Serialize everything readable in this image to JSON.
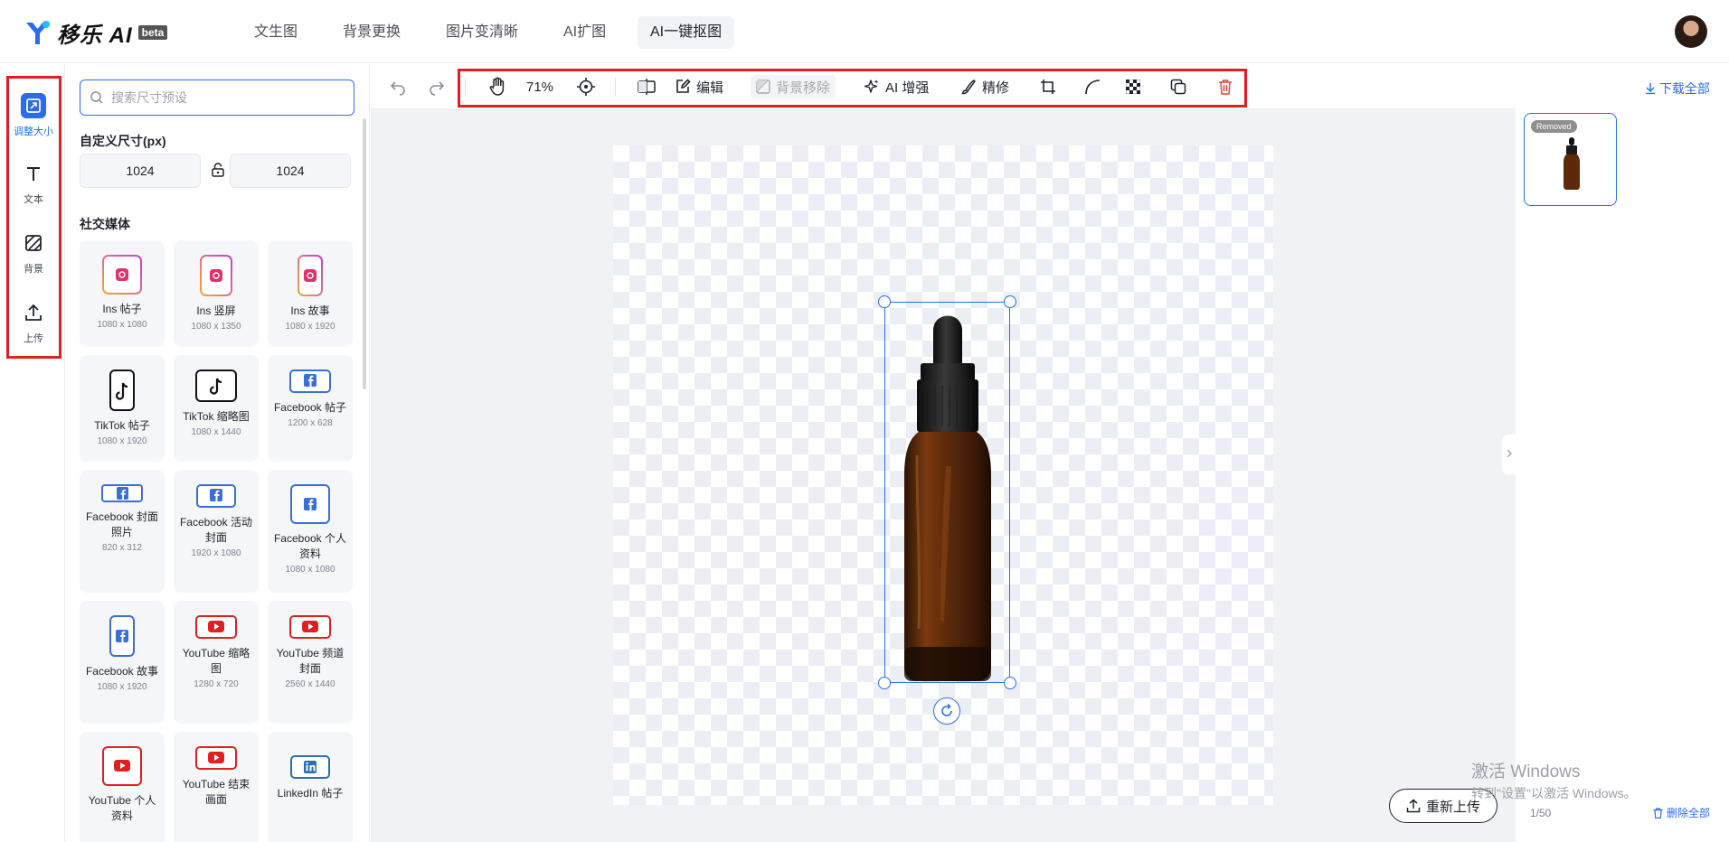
{
  "app": {
    "brand": "移乐 AI",
    "beta_badge": "beta"
  },
  "nav": {
    "tabs": [
      {
        "label": "文生图",
        "active": false
      },
      {
        "label": "背景更换",
        "active": false
      },
      {
        "label": "图片变清晰",
        "active": false
      },
      {
        "label": "AI扩图",
        "active": false
      },
      {
        "label": "AI一键抠图",
        "active": true
      }
    ]
  },
  "rail": {
    "items": [
      {
        "label": "调整大小",
        "icon": "resize-icon",
        "active": true
      },
      {
        "label": "文本",
        "icon": "text-icon",
        "active": false
      },
      {
        "label": "背景",
        "icon": "background-icon",
        "active": false
      },
      {
        "label": "上传",
        "icon": "upload-icon",
        "active": false
      }
    ]
  },
  "panel": {
    "search_placeholder": "搜索尺寸预设",
    "custom_size_label": "自定义尺寸(px)",
    "width": "1024",
    "height": "1024",
    "section_title": "社交媒体",
    "presets": [
      {
        "name": "Ins 帖子",
        "size": "1080 x 1080",
        "icon": "instagram-icon"
      },
      {
        "name": "Ins 竖屏",
        "size": "1080 x 1350",
        "icon": "instagram-icon"
      },
      {
        "name": "Ins 故事",
        "size": "1080 x 1920",
        "icon": "instagram-icon"
      },
      {
        "name": "TikTok 帖子",
        "size": "1080 x 1920",
        "icon": "tiktok-icon"
      },
      {
        "name": "TikTok 缩略图",
        "size": "1080 x 1440",
        "icon": "tiktok-icon"
      },
      {
        "name": "Facebook 帖子",
        "size": "1200 x 628",
        "icon": "facebook-icon"
      },
      {
        "name": "Facebook 封面照片",
        "size": "820 x 312",
        "icon": "facebook-icon"
      },
      {
        "name": "Facebook 活动封面",
        "size": "1920 x 1080",
        "icon": "facebook-icon"
      },
      {
        "name": "Facebook 个人资料",
        "size": "1080 x 1080",
        "icon": "facebook-icon"
      },
      {
        "name": "Facebook 故事",
        "size": "1080 x 1920",
        "icon": "facebook-icon"
      },
      {
        "name": "YouTube 缩略图",
        "size": "1280 x 720",
        "icon": "youtube-icon"
      },
      {
        "name": "YouTube 频道封面",
        "size": "2560 x 1440",
        "icon": "youtube-icon"
      },
      {
        "name": "YouTube 个人资料",
        "size": "",
        "icon": "youtube-icon"
      },
      {
        "name": "YouTube 结束画面",
        "size": "",
        "icon": "youtube-icon"
      },
      {
        "name": "LinkedIn 帖子",
        "size": "",
        "icon": "linkedin-icon"
      }
    ]
  },
  "toolbar": {
    "zoom": "71%",
    "edit_label": "编辑",
    "bg_remove_label": "背景移除",
    "ai_enhance_label": "AI 增强",
    "refine_label": "精修",
    "download_all": "下载全部"
  },
  "canvas": {
    "reupload_label": "重新上传"
  },
  "thumbnails": {
    "badge": "Removed",
    "count": "1/50",
    "delete_all": "删除全部"
  },
  "watermark": {
    "title": "激活 Windows",
    "subtitle": "转到\"设置\"以激活 Windows。"
  },
  "colors": {
    "accent": "#2b6bf3",
    "annotation": "#e02020",
    "delete": "#e0443b"
  }
}
